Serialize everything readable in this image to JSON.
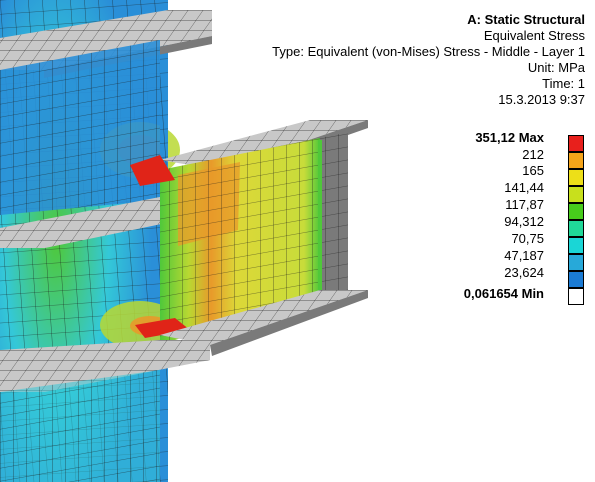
{
  "header": {
    "title": "A: Static Structural",
    "result": "Equivalent Stress",
    "type": "Type: Equivalent (von-Mises) Stress - Middle - Layer 1",
    "unit": "Unit: MPa",
    "time": "Time: 1",
    "date": "15.3.2013 9:37"
  },
  "legend": {
    "labels": [
      "351,12 Max",
      "212",
      "165",
      "141,44",
      "117,87",
      "94,312",
      "70,75",
      "47,187",
      "23,624",
      "0,061654 Min"
    ],
    "colors": [
      "#e8201c",
      "#f5a419",
      "#eddf18",
      "#c8e01c",
      "#47cc1c",
      "#20d899",
      "#1ad6d6",
      "#27a9d9",
      "#1b7bd4",
      "#ffffff"
    ]
  },
  "model_colors": {
    "blue": "#2a8fd8",
    "cyan": "#34c8d8",
    "green": "#4fc83a",
    "yellow_green": "#b9d832",
    "yellow": "#dcd838",
    "orange": "#e89a2a",
    "red": "#e02418",
    "gray": "#c8c8c8",
    "dark_gray": "#7a7a7a",
    "mesh": "#1a1a1a"
  }
}
